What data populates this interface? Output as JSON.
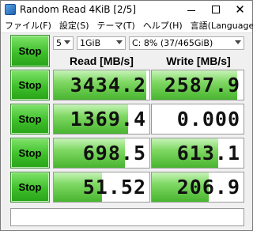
{
  "window": {
    "title": "Random Read 4KiB [2/5]"
  },
  "menu": [
    {
      "label": "ファイル(F)"
    },
    {
      "label": "設定(S)"
    },
    {
      "label": "テーマ(T)"
    },
    {
      "label": "ヘルプ(H)"
    },
    {
      "label": "言語(Language)"
    }
  ],
  "controls": {
    "count": "5",
    "size": "1GiB",
    "drive": "C: 8% (37/465GiB)"
  },
  "headers": {
    "read": "Read [MB/s]",
    "write": "Write [MB/s]"
  },
  "stop_label": "Stop",
  "rows": [
    {
      "read": "3434.2",
      "write": "2587.9",
      "read_fill": 0.97,
      "write_fill": 0.93
    },
    {
      "read": "1369.4",
      "write": "0.000",
      "read_fill": 0.78,
      "write_fill": 0.0
    },
    {
      "read": "698.5",
      "write": "613.1",
      "read_fill": 0.74,
      "write_fill": 0.72
    },
    {
      "read": "51.52",
      "write": "206.9",
      "read_fill": 0.5,
      "write_fill": 0.62
    }
  ],
  "comment": ""
}
